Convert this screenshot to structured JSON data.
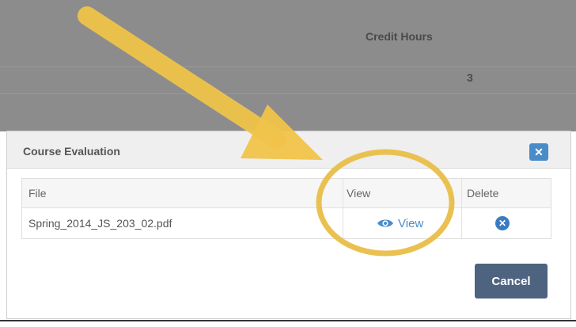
{
  "background_table": {
    "credit_hours_header": "Credit Hours",
    "credit_hours_value": "3"
  },
  "modal": {
    "title": "Course Evaluation",
    "close_icon": "close-icon",
    "columns": {
      "file": "File",
      "view": "View",
      "delete": "Delete"
    },
    "rows": [
      {
        "file": "Spring_2014_JS_203_02.pdf",
        "view_label": "View",
        "view_icon": "eye-icon",
        "delete_icon": "delete-circle-icon"
      }
    ],
    "cancel_label": "Cancel"
  },
  "colors": {
    "accent": "#4a8cc9",
    "cancel_button": "#4d6380",
    "annotation": "#f0c34a"
  }
}
